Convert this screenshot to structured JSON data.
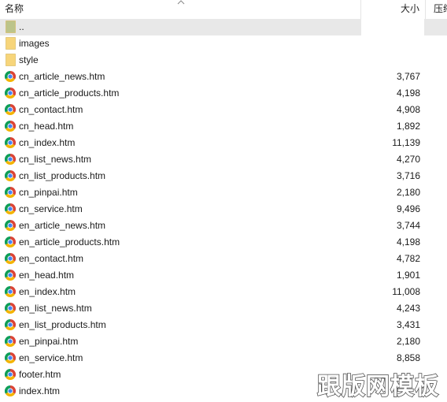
{
  "columns": {
    "name": "名称",
    "size": "大小",
    "compressed": "压缩"
  },
  "rows": [
    {
      "name": "..",
      "size": "",
      "type": "parent"
    },
    {
      "name": "images",
      "size": "",
      "type": "folder"
    },
    {
      "name": "style",
      "size": "",
      "type": "folder"
    },
    {
      "name": "cn_article_news.htm",
      "size": "3,767",
      "type": "htm"
    },
    {
      "name": "cn_article_products.htm",
      "size": "4,198",
      "type": "htm"
    },
    {
      "name": "cn_contact.htm",
      "size": "4,908",
      "type": "htm"
    },
    {
      "name": "cn_head.htm",
      "size": "1,892",
      "type": "htm"
    },
    {
      "name": "cn_index.htm",
      "size": "11,139",
      "type": "htm"
    },
    {
      "name": "cn_list_news.htm",
      "size": "4,270",
      "type": "htm"
    },
    {
      "name": "cn_list_products.htm",
      "size": "3,716",
      "type": "htm"
    },
    {
      "name": "cn_pinpai.htm",
      "size": "2,180",
      "type": "htm"
    },
    {
      "name": "cn_service.htm",
      "size": "9,496",
      "type": "htm"
    },
    {
      "name": "en_article_news.htm",
      "size": "3,744",
      "type": "htm"
    },
    {
      "name": "en_article_products.htm",
      "size": "4,198",
      "type": "htm"
    },
    {
      "name": "en_contact.htm",
      "size": "4,782",
      "type": "htm"
    },
    {
      "name": "en_head.htm",
      "size": "1,901",
      "type": "htm"
    },
    {
      "name": "en_index.htm",
      "size": "11,008",
      "type": "htm"
    },
    {
      "name": "en_list_news.htm",
      "size": "4,243",
      "type": "htm"
    },
    {
      "name": "en_list_products.htm",
      "size": "3,431",
      "type": "htm"
    },
    {
      "name": "en_pinpai.htm",
      "size": "2,180",
      "type": "htm"
    },
    {
      "name": "en_service.htm",
      "size": "8,858",
      "type": "htm"
    },
    {
      "name": "footer.htm",
      "size": "",
      "type": "htm"
    },
    {
      "name": "index.htm",
      "size": "",
      "type": "htm"
    }
  ],
  "watermark": "跟版网模板",
  "icons": {
    "folder": "folder-icon",
    "parent": "parent-folder-icon",
    "htm": "chrome-file-icon",
    "sort": "sort-ascending-icon"
  },
  "colors": {
    "folder": "#f7d57a",
    "parent": "#bcc48a",
    "chrome_red": "#db4437",
    "chrome_green": "#0f9d58",
    "chrome_yellow": "#f4b400",
    "chrome_blue": "#4285f4"
  }
}
